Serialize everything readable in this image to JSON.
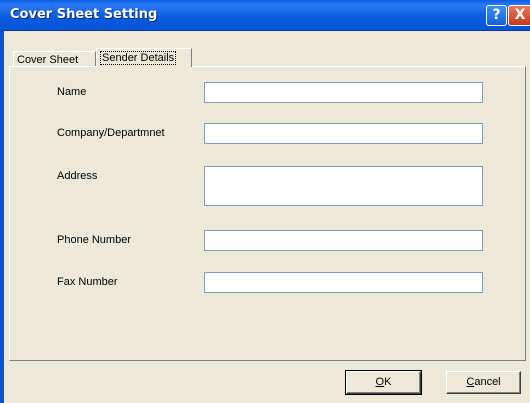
{
  "window": {
    "title": "Cover Sheet Setting",
    "help_glyph": "?",
    "close_glyph": "X"
  },
  "tabs": [
    {
      "label": "Cover Sheet",
      "selected": false
    },
    {
      "label": "Sender Details",
      "selected": true
    }
  ],
  "form": {
    "name": {
      "label": "Name",
      "value": ""
    },
    "company": {
      "label": "Company/Departmnet",
      "value": ""
    },
    "address": {
      "label": "Address",
      "value": ""
    },
    "phone": {
      "label": "Phone Number",
      "value": ""
    },
    "fax": {
      "label": "Fax Number",
      "value": ""
    }
  },
  "buttons": {
    "ok": {
      "label": "OK",
      "access_key": "O",
      "rest": "K"
    },
    "cancel": {
      "label": "Cancel",
      "access_key": "C",
      "rest": "ancel"
    }
  }
}
